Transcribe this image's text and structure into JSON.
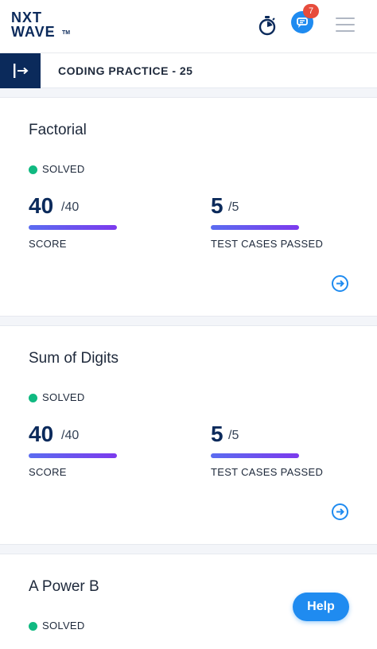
{
  "header": {
    "logo": {
      "line1": "NXT",
      "line2": "WAVE",
      "tm": "TM"
    },
    "notification_count": "7",
    "icons": {
      "timer": "stopwatch-icon",
      "chat": "chat-icon",
      "menu": "hamburger-menu-icon"
    }
  },
  "subheader": {
    "title": "CODING PRACTICE - 25",
    "collapse_icon": "collapse-sidebar-icon"
  },
  "problems": [
    {
      "title": "Factorial",
      "status": "SOLVED",
      "score": "40",
      "score_total": "/40",
      "score_label": "SCORE",
      "tests": "5",
      "tests_total": "/5",
      "tests_label": "TEST CASES PASSED"
    },
    {
      "title": "Sum of Digits",
      "status": "SOLVED",
      "score": "40",
      "score_total": "/40",
      "score_label": "SCORE",
      "tests": "5",
      "tests_total": "/5",
      "tests_label": "TEST CASES PASSED"
    },
    {
      "title": "A Power B",
      "status": "SOLVED"
    }
  ],
  "help_button": {
    "label": "Help"
  },
  "colors": {
    "brand_navy": "#0b2a5b",
    "accent_blue": "#1f8bf0",
    "solved_green": "#10b981",
    "progress_start": "#5b6cf0",
    "progress_end": "#7c3aed",
    "badge_red": "#e74c3c"
  },
  "progress": {
    "score_fraction": 1.0,
    "tests_fraction": 1.0
  }
}
